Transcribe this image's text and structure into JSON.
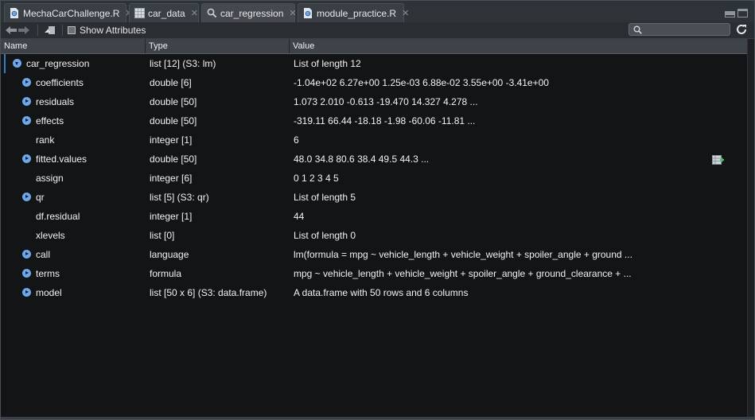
{
  "tabs": [
    {
      "label": "MechaCarChallenge.R",
      "icon": "r-script-icon",
      "active": false
    },
    {
      "label": "car_data",
      "icon": "table-grid-icon",
      "active": false
    },
    {
      "label": "car_regression",
      "icon": "magnifier-icon",
      "active": true
    },
    {
      "label": "module_practice.R",
      "icon": "r-script-icon",
      "active": false
    }
  ],
  "toolbar": {
    "show_attributes_label": "Show Attributes",
    "show_attributes_checked": false,
    "search_placeholder": ""
  },
  "columns": {
    "name": "Name",
    "type": "Type",
    "value": "Value"
  },
  "rows": [
    {
      "name": "car_regression",
      "type": "list [12] (S3: lm)",
      "value": "List of length 12",
      "expandable": true,
      "expanded": true,
      "root": true
    },
    {
      "name": "coefficients",
      "type": "double [6]",
      "value": "-1.04e+02 6.27e+00 1.25e-03 6.88e-02 3.55e+00 -3.41e+00",
      "expandable": true
    },
    {
      "name": "residuals",
      "type": "double [50]",
      "value": "1.073 2.010 -0.613 -19.470 14.327 4.278 ...",
      "expandable": true
    },
    {
      "name": "effects",
      "type": "double [50]",
      "value": "-319.11 66.44 -18.18 -1.98 -60.06 -11.81 ...",
      "expandable": true
    },
    {
      "name": "rank",
      "type": "integer [1]",
      "value": "6",
      "expandable": false
    },
    {
      "name": "fitted.values",
      "type": "double [50]",
      "value": "48.0 34.8 80.6 38.4 49.5 44.3 ...",
      "expandable": true
    },
    {
      "name": "assign",
      "type": "integer [6]",
      "value": "0 1 2 3 4 5",
      "expandable": false
    },
    {
      "name": "qr",
      "type": "list [5] (S3: qr)",
      "value": "List of length 5",
      "expandable": true
    },
    {
      "name": "df.residual",
      "type": "integer [1]",
      "value": "44",
      "expandable": false
    },
    {
      "name": "xlevels",
      "type": "list [0]",
      "value": "List of length 0",
      "expandable": false
    },
    {
      "name": "call",
      "type": "language",
      "value": "lm(formula = mpg ~ vehicle_length + vehicle_weight + spoiler_angle + ground ...",
      "expandable": true
    },
    {
      "name": "terms",
      "type": "formula",
      "value": "mpg ~ vehicle_length + vehicle_weight + spoiler_angle + ground_clearance + ...",
      "expandable": true
    },
    {
      "name": "model",
      "type": "list [50 x 6] (S3: data.frame)",
      "value": "A data.frame with 50 rows and 6 columns",
      "expandable": true
    }
  ],
  "colors": {
    "accent": "#6fa6e8",
    "background": "#131416"
  }
}
